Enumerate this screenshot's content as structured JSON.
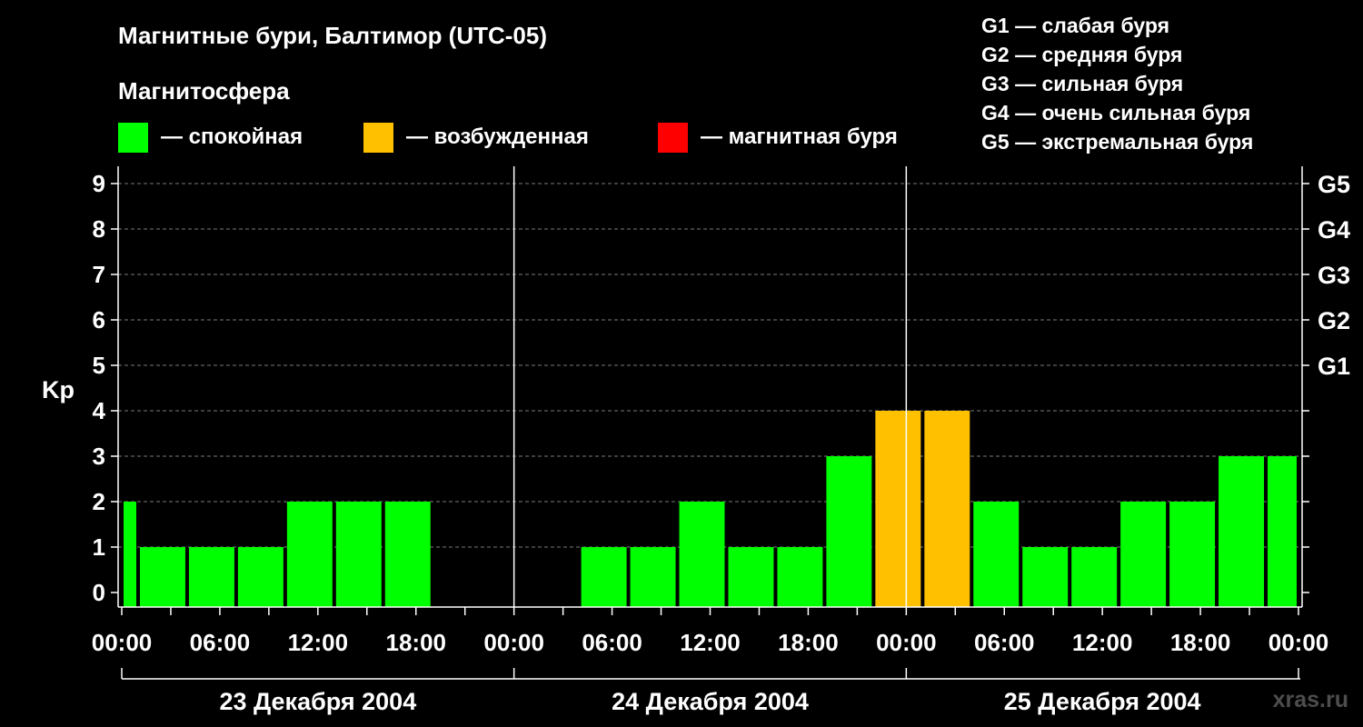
{
  "title": "Магнитные бури, Балтимор (UTC-05)",
  "magnetosphere_label": "Магнитосфера",
  "legend": [
    {
      "color": "#00ff00",
      "label": "— спокойная"
    },
    {
      "color": "#ffc000",
      "label": "— возбужденная"
    },
    {
      "color": "#ff0000",
      "label": "— магнитная буря"
    }
  ],
  "g_legend": [
    "G1 — слабая буря",
    "G2 — средняя буря",
    "G3 — сильная буря",
    "G4 — очень сильная буря",
    "G5 — экстремальная буря"
  ],
  "watermark": "xras.ru",
  "chart_data": {
    "type": "bar",
    "ylabel": "Kp",
    "ylim": [
      0,
      9
    ],
    "yticks": [
      0,
      1,
      2,
      3,
      4,
      5,
      6,
      7,
      8,
      9
    ],
    "right_axis_labels": [
      {
        "value": 5,
        "label": "G1"
      },
      {
        "value": 6,
        "label": "G2"
      },
      {
        "value": 7,
        "label": "G3"
      },
      {
        "value": 8,
        "label": "G4"
      },
      {
        "value": 9,
        "label": "G5"
      }
    ],
    "x_range_hours": [
      0,
      72
    ],
    "x_tick_labels": [
      {
        "hour": 0,
        "label": "00:00"
      },
      {
        "hour": 6,
        "label": "06:00"
      },
      {
        "hour": 12,
        "label": "12:00"
      },
      {
        "hour": 18,
        "label": "18:00"
      },
      {
        "hour": 24,
        "label": "00:00"
      },
      {
        "hour": 30,
        "label": "06:00"
      },
      {
        "hour": 36,
        "label": "12:00"
      },
      {
        "hour": 42,
        "label": "18:00"
      },
      {
        "hour": 48,
        "label": "00:00"
      },
      {
        "hour": 54,
        "label": "06:00"
      },
      {
        "hour": 60,
        "label": "12:00"
      },
      {
        "hour": 66,
        "label": "18:00"
      },
      {
        "hour": 72,
        "label": "00:00"
      }
    ],
    "days": [
      {
        "start": 0,
        "end": 24,
        "label": "23 Декабря 2004"
      },
      {
        "start": 24,
        "end": 48,
        "label": "24 Декабря 2004"
      },
      {
        "start": 48,
        "end": 72,
        "label": "25 Декабря 2004"
      }
    ],
    "day_boundaries": [
      24,
      48
    ],
    "bars": [
      {
        "start": 0,
        "end": 1,
        "kp": 2,
        "color": "#00ff00"
      },
      {
        "start": 1,
        "end": 4,
        "kp": 1,
        "color": "#00ff00"
      },
      {
        "start": 4,
        "end": 7,
        "kp": 1,
        "color": "#00ff00"
      },
      {
        "start": 7,
        "end": 10,
        "kp": 1,
        "color": "#00ff00"
      },
      {
        "start": 10,
        "end": 13,
        "kp": 2,
        "color": "#00ff00"
      },
      {
        "start": 13,
        "end": 16,
        "kp": 2,
        "color": "#00ff00"
      },
      {
        "start": 16,
        "end": 19,
        "kp": 2,
        "color": "#00ff00"
      },
      {
        "start": 28,
        "end": 31,
        "kp": 1,
        "color": "#00ff00"
      },
      {
        "start": 31,
        "end": 34,
        "kp": 1,
        "color": "#00ff00"
      },
      {
        "start": 34,
        "end": 37,
        "kp": 2,
        "color": "#00ff00"
      },
      {
        "start": 37,
        "end": 40,
        "kp": 1,
        "color": "#00ff00"
      },
      {
        "start": 40,
        "end": 43,
        "kp": 1,
        "color": "#00ff00"
      },
      {
        "start": 43,
        "end": 46,
        "kp": 3,
        "color": "#00ff00"
      },
      {
        "start": 46,
        "end": 49,
        "kp": 4,
        "color": "#ffc000"
      },
      {
        "start": 49,
        "end": 52,
        "kp": 4,
        "color": "#ffc000"
      },
      {
        "start": 52,
        "end": 55,
        "kp": 2,
        "color": "#00ff00"
      },
      {
        "start": 55,
        "end": 58,
        "kp": 1,
        "color": "#00ff00"
      },
      {
        "start": 58,
        "end": 61,
        "kp": 1,
        "color": "#00ff00"
      },
      {
        "start": 61,
        "end": 64,
        "kp": 2,
        "color": "#00ff00"
      },
      {
        "start": 64,
        "end": 67,
        "kp": 2,
        "color": "#00ff00"
      },
      {
        "start": 67,
        "end": 70,
        "kp": 3,
        "color": "#00ff00"
      },
      {
        "start": 70,
        "end": 72,
        "kp": 3,
        "color": "#00ff00"
      }
    ]
  }
}
